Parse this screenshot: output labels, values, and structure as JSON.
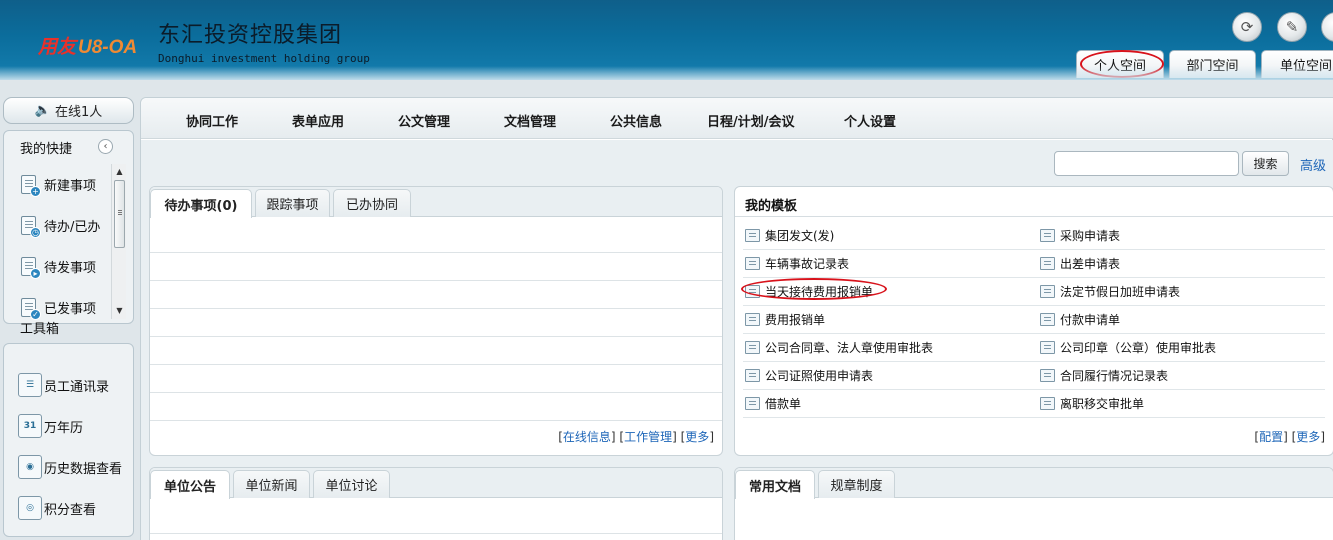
{
  "header": {
    "logo_part1": "用友",
    "logo_part2": "U8-OA",
    "company_name": "东汇投资控股集团",
    "company_name_en": "Donghui investment holding group",
    "space_tabs": [
      "个人空间",
      "部门空间",
      "单位空间"
    ]
  },
  "sidebar": {
    "online_label": "在线1人",
    "quick_title": "我的快捷",
    "quick_items": [
      "新建事项",
      "待办/已办",
      "待发事项",
      "已发事项"
    ],
    "tools_title": "工具箱",
    "tool_items": [
      "员工通讯录",
      "万年历",
      "历史数据查看",
      "积分查看"
    ],
    "calendar_day": "31"
  },
  "menu": {
    "items": [
      "协同工作",
      "表单应用",
      "公文管理",
      "文档管理",
      "公共信息",
      "日程/计划/会议",
      "个人设置"
    ]
  },
  "search": {
    "value": "",
    "button_label": "搜索",
    "advanced_label": "高级"
  },
  "pending": {
    "tabs": [
      "待办事项(0)",
      "跟踪事项",
      "已办协同"
    ],
    "footer_links": [
      "在线信息",
      "工作管理",
      "更多"
    ]
  },
  "templates": {
    "title": "我的模板",
    "left": [
      "集团发文(发)",
      "车辆事故记录表",
      "当天接待费用报销单",
      "费用报销单",
      "公司合同章、法人章使用审批表",
      "公司证照使用申请表",
      "借款单"
    ],
    "right": [
      "采购申请表",
      "出差申请表",
      "法定节假日加班申请表",
      "付款申请单",
      "公司印章（公章）使用审批表",
      "合同履行情况记录表",
      "离职移交审批单"
    ],
    "footer_links": [
      "配置",
      "更多"
    ]
  },
  "bulletin": {
    "tabs": [
      "单位公告",
      "单位新闻",
      "单位讨论"
    ]
  },
  "docs": {
    "tabs": [
      "常用文档",
      "规章制度"
    ]
  },
  "colors": {
    "header_blue": "#0b6d9c",
    "link_blue": "#1e66b8",
    "highlight_red": "#d8121b"
  }
}
